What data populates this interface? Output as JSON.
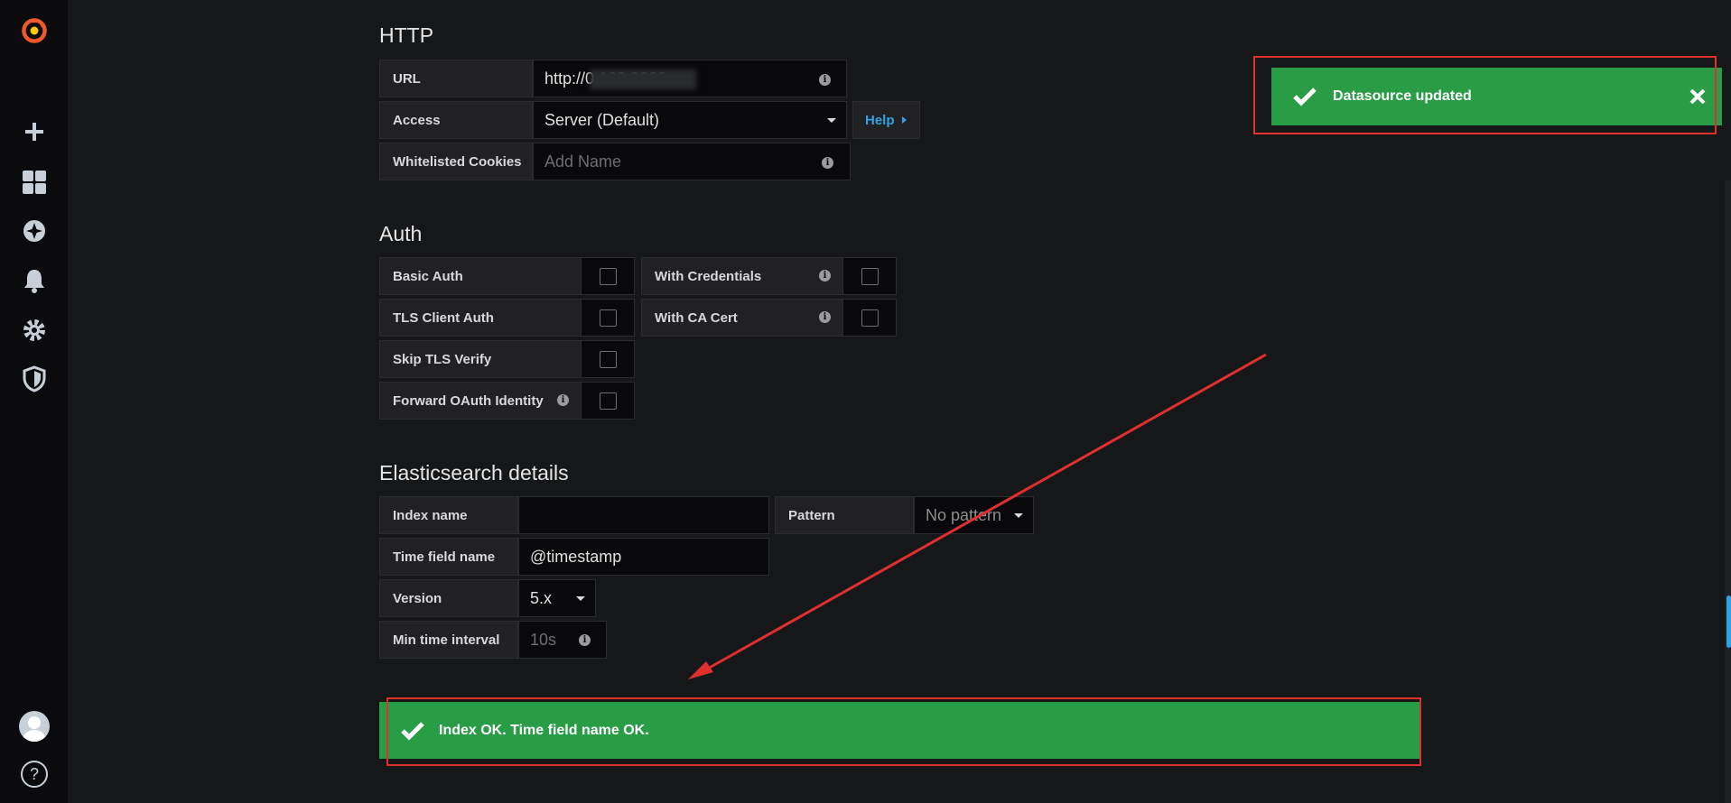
{
  "sidebar": {
    "items": [
      {
        "icon": "grafana-logo-icon"
      },
      {
        "icon": "plus-icon"
      },
      {
        "icon": "dashboards-icon"
      },
      {
        "icon": "explore-compass-icon"
      },
      {
        "icon": "alerting-bell-icon"
      },
      {
        "icon": "configuration-gear-icon"
      },
      {
        "icon": "server-admin-shield-icon"
      },
      {
        "icon": "user-avatar-icon"
      },
      {
        "icon": "help-icon"
      }
    ],
    "help_glyph": "?"
  },
  "http": {
    "title": "HTTP",
    "url_label": "URL",
    "url_value": "http://0          168:9200",
    "access_label": "Access",
    "access_value": "Server (Default)",
    "help_label": "Help",
    "cookies_label": "Whitelisted Cookies",
    "cookies_placeholder": "Add Name"
  },
  "auth": {
    "title": "Auth",
    "basic_auth": "Basic Auth",
    "with_credentials": "With Credentials",
    "tls_client_auth": "TLS Client Auth",
    "with_ca_cert": "With CA Cert",
    "skip_tls_verify": "Skip TLS Verify",
    "forward_oauth": "Forward OAuth Identity"
  },
  "elasticsearch": {
    "title": "Elasticsearch details",
    "index_name_label": "Index name",
    "index_name_value": "",
    "pattern_label": "Pattern",
    "pattern_value": "No pattern",
    "time_field_label": "Time field name",
    "time_field_value": "@timestamp",
    "version_label": "Version",
    "version_value": "5.x",
    "min_interval_label": "Min time interval",
    "min_interval_placeholder": "10s"
  },
  "alerts": {
    "datasource_updated": "Datasource updated",
    "index_ok": "Index OK. Time field name OK."
  },
  "colors": {
    "background": "#161719",
    "sidebar": "#0b0b0d",
    "success": "#299c46",
    "link": "#33a2e5",
    "annotation": "#e02f2f",
    "logo": "#f05a28"
  }
}
